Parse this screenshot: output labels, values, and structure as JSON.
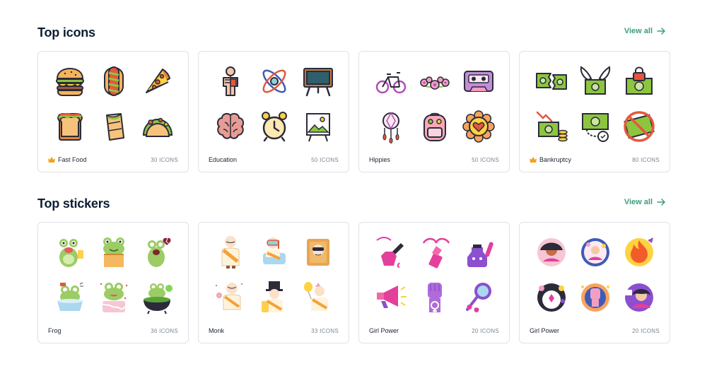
{
  "top_icons": {
    "title": "Top icons",
    "view_all": "View all",
    "cards": [
      {
        "name": "Fast Food",
        "count": "30 ICONS",
        "premium": true,
        "icons": [
          "burger-icon",
          "hotdog-icon",
          "pizza-icon",
          "sandwich-icon",
          "burrito-icon",
          "taco-icon"
        ]
      },
      {
        "name": "Education",
        "count": "50 ICONS",
        "premium": false,
        "icons": [
          "anatomy-icon",
          "atom-icon",
          "blackboard-icon",
          "brain-icon",
          "alarm-clock-icon",
          "easel-icon"
        ]
      },
      {
        "name": "Hippies",
        "count": "50 ICONS",
        "premium": false,
        "icons": [
          "bicycle-icon",
          "flower-crown-icon",
          "cassette-icon",
          "dreamcatcher-icon",
          "backpack-icon",
          "flower-heart-icon"
        ]
      },
      {
        "name": "Bankruptcy",
        "count": "80 ICONS",
        "premium": true,
        "icons": [
          "torn-money-icon",
          "flying-money-icon",
          "locked-money-icon",
          "money-loss-icon",
          "money-chained-icon",
          "no-money-icon"
        ]
      }
    ]
  },
  "top_stickers": {
    "title": "Top stickers",
    "view_all": "View all",
    "cards": [
      {
        "name": "Frog",
        "count": "36 ICONS",
        "stickers": [
          "frog-beer-sticker",
          "frog-box-sticker",
          "frog-heartbreak-sticker",
          "frog-cup-sticker",
          "frog-cake-sticker",
          "frog-cauldron-sticker"
        ]
      },
      {
        "name": "Monk",
        "count": "33 ICONS",
        "stickers": [
          "monk-sticker",
          "monk-snorkel-sticker",
          "monk-book-sticker",
          "monk-flower-sticker",
          "monk-tophat-sticker",
          "monk-balloon-sticker"
        ]
      },
      {
        "name": "Girl Power",
        "count": "20 ICONS",
        "stickers": [
          "nail-polish-sticker",
          "lipstick-sticker",
          "potion-sticker",
          "megaphone-sticker",
          "fist-sticker",
          "mirror-sticker"
        ]
      },
      {
        "name": "Girl Power",
        "count": "20 ICONS",
        "stickers": [
          "girl-badge-sticker",
          "girl-flowers-badge-sticker",
          "fire-badge-sticker",
          "girl-pwr-badge-sticker",
          "fist-badge-sticker",
          "pwr-girl-badge-sticker"
        ]
      }
    ]
  },
  "colors": {
    "accent": "#3c9c7f",
    "heading": "#0e1e33",
    "border": "#dde2e8",
    "premium": "#f2a31b"
  }
}
